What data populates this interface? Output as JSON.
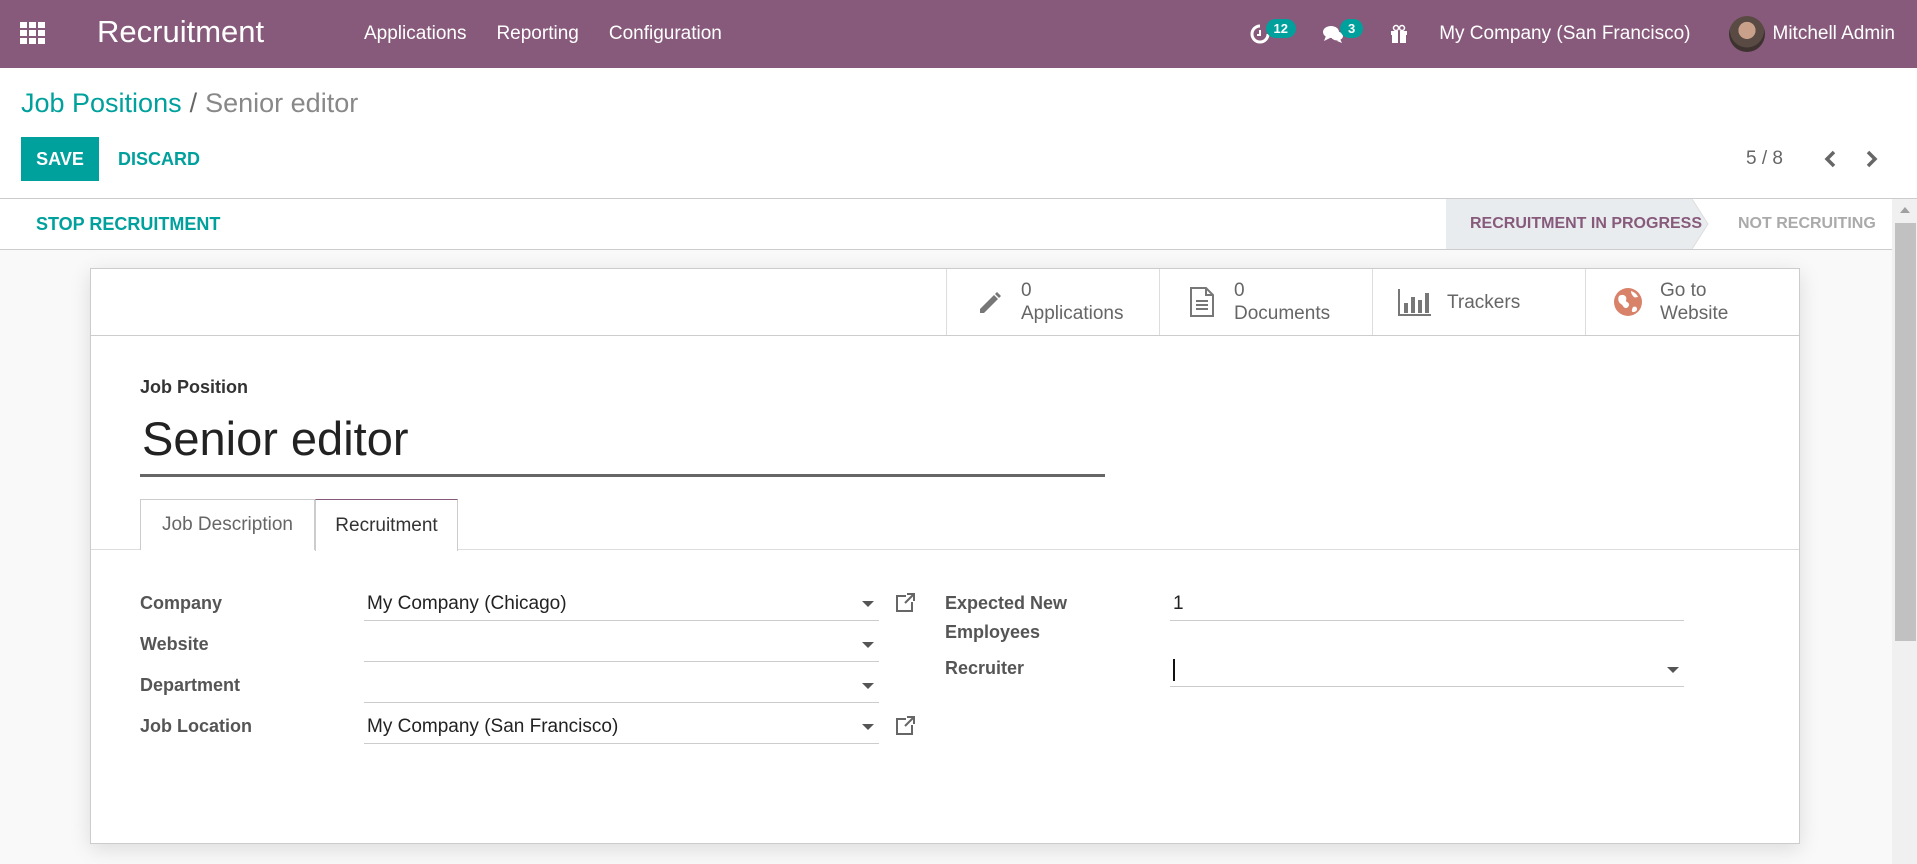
{
  "navbar": {
    "app_title": "Recruitment",
    "menu": [
      "Applications",
      "Reporting",
      "Configuration"
    ],
    "activity_count": "12",
    "messages_count": "3",
    "company": "My Company (San Francisco)",
    "user": "Mitchell Admin",
    "brand_color": "#875a7b"
  },
  "breadcrumb": {
    "parent": "Job Positions",
    "separator": "/",
    "current": "Senior editor"
  },
  "actions": {
    "save": "SAVE",
    "discard": "DISCARD"
  },
  "pager": {
    "value": "5 / 8"
  },
  "statusbar": {
    "stop_button": "STOP RECRUITMENT",
    "stages": [
      {
        "label": "RECRUITMENT IN PROGRESS",
        "active": true
      },
      {
        "label": "NOT RECRUITING",
        "active": false
      }
    ]
  },
  "stat_buttons": [
    {
      "icon": "pencil-icon",
      "count": "0",
      "label": "Applications"
    },
    {
      "icon": "document-icon",
      "count": "0",
      "label": "Documents"
    },
    {
      "icon": "bar-chart-icon",
      "count": "",
      "label": "Trackers"
    },
    {
      "icon": "globe-icon",
      "count": "",
      "label": "Go to Website"
    }
  ],
  "stat_labels": {
    "go_to": "Go to",
    "website": "Website"
  },
  "form": {
    "title_label": "Job Position",
    "title_value": "Senior editor",
    "tabs": [
      {
        "label": "Job Description",
        "active": false
      },
      {
        "label": "Recruitment",
        "active": true
      }
    ],
    "left_fields": [
      {
        "label": "Company",
        "value": "My Company (Chicago)"
      },
      {
        "label": "Website",
        "value": ""
      },
      {
        "label": "Department",
        "value": ""
      },
      {
        "label": "Job Location",
        "value": "My Company (San Francisco)"
      }
    ],
    "right_fields": [
      {
        "label_line1": "Expected New",
        "label_line2": "Employees",
        "value": "1"
      },
      {
        "label": "Recruiter",
        "value": ""
      }
    ]
  },
  "colors": {
    "accent": "#00a09d",
    "brand": "#875a7b"
  }
}
